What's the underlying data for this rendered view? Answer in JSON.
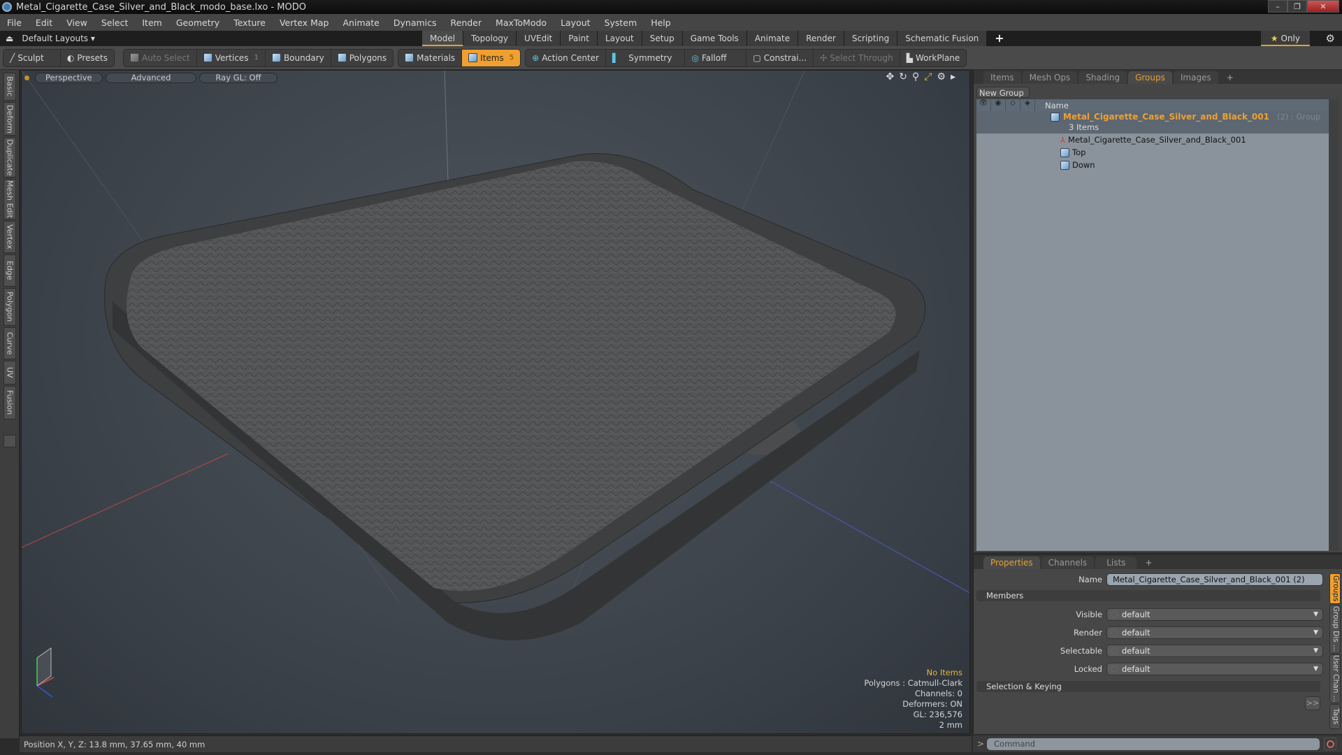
{
  "window": {
    "title": "Metal_Cigarette_Case_Silver_and_Black_modo_base.lxo - MODO",
    "minimize": "–",
    "restore": "❐",
    "close": "✕"
  },
  "menu": [
    "File",
    "Edit",
    "View",
    "Select",
    "Item",
    "Geometry",
    "Texture",
    "Vertex Map",
    "Animate",
    "Dynamics",
    "Render",
    "MaxToModo",
    "Layout",
    "System",
    "Help"
  ],
  "layoutbar": {
    "layouts_label": "Default Layouts ▾",
    "tabs": [
      "Model",
      "Topology",
      "UVEdit",
      "Paint",
      "Layout",
      "Setup",
      "Game Tools",
      "Animate",
      "Render",
      "Scripting",
      "Schematic Fusion"
    ],
    "active_tab": "Model",
    "add": "+",
    "only_label": "Only",
    "star": "★"
  },
  "toolbar": {
    "sculpt": "Sculpt",
    "presets": "Presets",
    "auto_select": "Auto Select",
    "vertices": "Vertices",
    "vertices_count": "1",
    "boundary": "Boundary",
    "polygons": "Polygons",
    "materials": "Materials",
    "items": "Items",
    "items_count": "5",
    "action_center": "Action Center",
    "symmetry": "Symmetry",
    "falloff": "Falloff",
    "constraints": "Constrai...",
    "select_through": "Select Through",
    "workplane": "WorkPlane"
  },
  "left_tabs": [
    "Basic",
    "Deform",
    "Duplicate",
    "Mesh Edit",
    "Vertex",
    "Edge",
    "Polygon",
    "Curve",
    "UV",
    "Fusion"
  ],
  "viewport": {
    "view": "Perspective",
    "shading": "Advanced",
    "raygl": "Ray GL: Off",
    "stats": {
      "selection": "No Items",
      "polygons": "Polygons : Catmull-Clark",
      "channels": "Channels: 0",
      "deformers": "Deformers: ON",
      "gl": "GL: 236,576",
      "scale": "2 mm"
    }
  },
  "status": {
    "position": "Position X, Y, Z:   13.8 mm, 37.65 mm, 40 mm"
  },
  "groups_panel": {
    "tabs": [
      "Items",
      "Mesh Ops",
      "Shading",
      "Groups",
      "Images"
    ],
    "active_tab": "Groups",
    "add": "+",
    "new_group": "New Group",
    "name_header": "Name",
    "group": {
      "name": "Metal_Cigarette_Case_Silver_and_Black_001",
      "suffix": "(2) : Group",
      "count": "3 Items"
    },
    "items": [
      {
        "name": "Metal_Cigarette_Case_Silver_and_Black_001",
        "icon": "locator"
      },
      {
        "name": "Top",
        "icon": "mesh"
      },
      {
        "name": "Down",
        "icon": "mesh"
      }
    ]
  },
  "properties_panel": {
    "tabs": [
      "Properties",
      "Channels",
      "Lists"
    ],
    "active_tab": "Properties",
    "add": "+",
    "name_label": "Name",
    "name_value": "Metal_Cigarette_Case_Silver_and_Black_001 (2)",
    "members_section": "Members",
    "fields": [
      {
        "label": "Visible",
        "value": "default"
      },
      {
        "label": "Render",
        "value": "default"
      },
      {
        "label": "Selectable",
        "value": "default"
      },
      {
        "label": "Locked",
        "value": "default"
      }
    ],
    "selection_section": "Selection & Keying",
    "more": ">>",
    "side_tabs": [
      "Groups",
      "Group Dis ...",
      "User Chan ...",
      "Tags"
    ]
  },
  "command": {
    "prompt": ">",
    "placeholder": "Command"
  },
  "colors": {
    "accent": "#f0a030",
    "group_name": "#f0a030"
  }
}
